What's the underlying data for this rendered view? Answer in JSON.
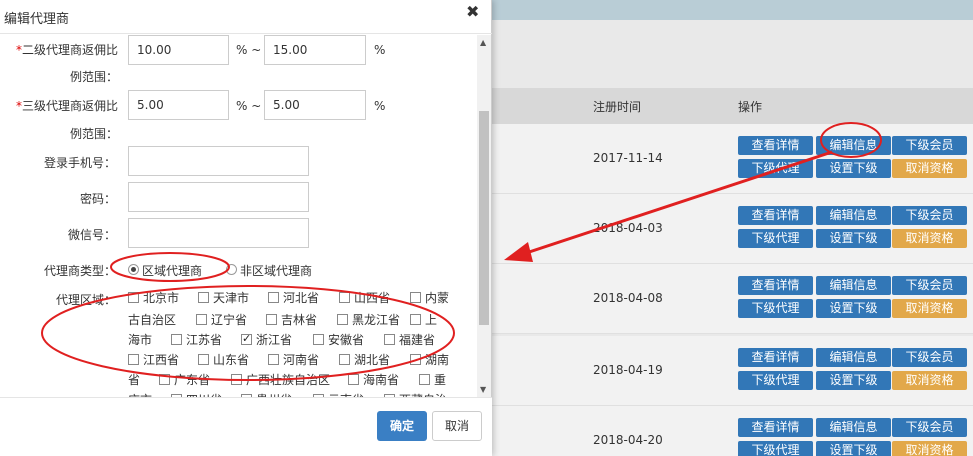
{
  "modal": {
    "title": "编辑代理商",
    "close_symbol": "✖",
    "fields": {
      "level2_label_a": "二级代理商返佣比",
      "level2_label_b": "例范围：",
      "level2_min": "10.00",
      "level2_max": "15.00",
      "level3_label_a": "三级代理商返佣比",
      "level3_label_b": "例范围：",
      "level3_min": "5.00",
      "level3_max": "5.00",
      "required_mark": "*",
      "percent_tilde": "% ~",
      "percent": "%",
      "phone_label": "登录手机号：",
      "password_label": "密码：",
      "wechat_label": "微信号：",
      "type_label": "代理商类型：",
      "type_options": [
        "区域代理商",
        "非区域代理商"
      ],
      "type_selected": "区域代理商",
      "region_label": "代理区域："
    },
    "regions": [
      {
        "text": "北京市",
        "checked": false
      },
      {
        "text": "天津市",
        "checked": false
      },
      {
        "text": "河北省",
        "checked": false
      },
      {
        "text": "山西省",
        "checked": false
      },
      {
        "text": "内蒙",
        "checked": false
      },
      {
        "text": "古自治区",
        "checked": false
      },
      {
        "text": "辽宁省",
        "checked": false
      },
      {
        "text": "吉林省",
        "checked": false
      },
      {
        "text": "黑龙江省",
        "checked": false
      },
      {
        "text": "上",
        "checked": false
      },
      {
        "text": "海市",
        "checked": false
      },
      {
        "text": "江苏省",
        "checked": false
      },
      {
        "text": "浙江省",
        "checked": true
      },
      {
        "text": "安徽省",
        "checked": false
      },
      {
        "text": "福建省",
        "checked": false
      },
      {
        "text": "江西省",
        "checked": false
      },
      {
        "text": "山东省",
        "checked": false
      },
      {
        "text": "河南省",
        "checked": false
      },
      {
        "text": "湖北省",
        "checked": false
      },
      {
        "text": "湖南",
        "checked": false
      },
      {
        "text": "省",
        "checked": false
      },
      {
        "text": "广东省",
        "checked": false
      },
      {
        "text": "广西壮族自治区",
        "checked": false
      },
      {
        "text": "海南省",
        "checked": false
      },
      {
        "text": "重",
        "checked": false
      },
      {
        "text": "庆市",
        "checked": false
      },
      {
        "text": "四川省",
        "checked": false
      },
      {
        "text": "贵州省",
        "checked": false
      },
      {
        "text": "云南省",
        "checked": false
      },
      {
        "text": "西藏自治",
        "checked": false
      }
    ],
    "footer": {
      "ok": "确定",
      "cancel": "取消"
    }
  },
  "table": {
    "headers": {
      "reg_time": "注册时间",
      "actions": "操作"
    },
    "rows": [
      {
        "date": "2017-11-14"
      },
      {
        "date": "2018-04-03"
      },
      {
        "date": "2018-04-08"
      },
      {
        "date": "2018-04-19"
      },
      {
        "date": "2018-04-20"
      }
    ],
    "action_buttons": {
      "detail": "查看详情",
      "edit": "编辑信息",
      "sub_members": "下级会员",
      "sub_agents": "下级代理",
      "set_sub": "设置下级",
      "cancel_qual": "取消资格"
    }
  },
  "colors": {
    "primary": "#3277b7",
    "warning": "#e2a84a",
    "annotation": "#e02020"
  }
}
